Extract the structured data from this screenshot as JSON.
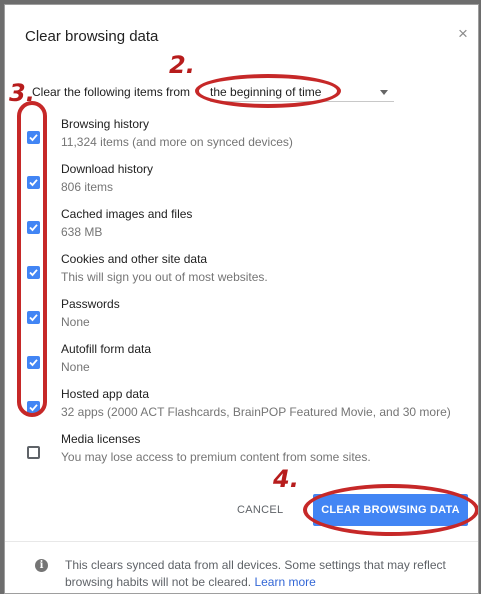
{
  "dialog": {
    "title": "Clear browsing data",
    "close_glyph": "×",
    "range_label": "Clear the following items from",
    "range_value": "the beginning of time",
    "items": [
      {
        "label": "Browsing history",
        "sub": "11,324 items (and more on synced devices)",
        "checked": true
      },
      {
        "label": "Download history",
        "sub": "806 items",
        "checked": true
      },
      {
        "label": "Cached images and files",
        "sub": "638 MB",
        "checked": true
      },
      {
        "label": "Cookies and other site data",
        "sub": "This will sign you out of most websites.",
        "checked": true
      },
      {
        "label": "Passwords",
        "sub": "None",
        "checked": true
      },
      {
        "label": "Autofill form data",
        "sub": "None",
        "checked": true
      },
      {
        "label": "Hosted app data",
        "sub": "32 apps (2000 ACT Flashcards, BrainPOP Featured Movie, and 30 more)",
        "checked": true
      },
      {
        "label": "Media licenses",
        "sub": "You may lose access to premium content from some sites.",
        "checked": false
      }
    ],
    "cancel_label": "CANCEL",
    "clear_label": "CLEAR BROWSING DATA",
    "footer_text": "This clears synced data from all devices. Some settings that may reflect browsing habits will not be cleared.",
    "learn_more": "Learn more",
    "info_glyph": "i"
  },
  "annotations": {
    "step2": "2.",
    "step3": "3.",
    "step4": "4."
  },
  "colors": {
    "accent": "#4285f4",
    "annotation": "#c62828"
  }
}
